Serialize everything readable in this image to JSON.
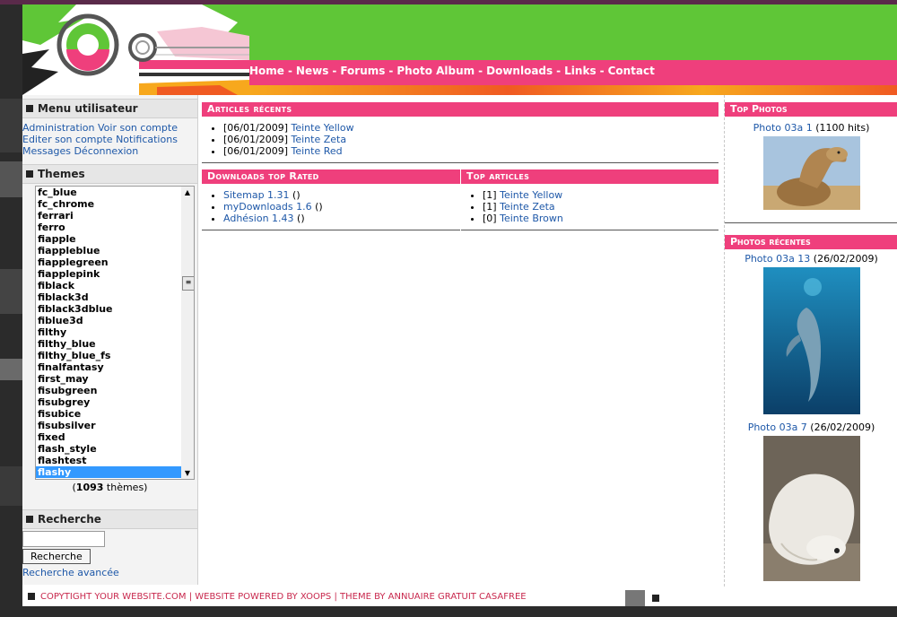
{
  "nav": [
    "Home",
    "News",
    "Forums",
    "Photo Album",
    "Downloads",
    "Links",
    "Contact"
  ],
  "nav_sep": "-",
  "user_menu": {
    "title": "Menu utilisateur",
    "links": [
      "Administration",
      "Voir son compte",
      "Editer son compte",
      "Notifications",
      "Messages",
      "Déconnexion"
    ]
  },
  "themes": {
    "title": "Themes",
    "items": [
      "fc_blue",
      "fc_chrome",
      "ferrari",
      "ferro",
      "fiapple",
      "fiappleblue",
      "fiapplegreen",
      "fiapplepink",
      "fiblack",
      "fiblack3d",
      "fiblack3dblue",
      "fiblue3d",
      "filthy",
      "filthy_blue",
      "filthy_blue_fs",
      "finalfantasy",
      "first_may",
      "fisubgreen",
      "fisubgrey",
      "fisubice",
      "fisubsilver",
      "fixed",
      "flash_style",
      "flashtest",
      "flashy"
    ],
    "selected": "flashy",
    "count_open": "(",
    "count": "1093",
    "count_label": " thèmes)"
  },
  "search": {
    "title": "Recherche",
    "input_value": "",
    "button": "Recherche",
    "advanced": "Recherche avancée"
  },
  "articles_recents": {
    "title": "Articles récents",
    "items": [
      {
        "date": "[06/01/2009]",
        "link": "Teinte Yellow"
      },
      {
        "date": "[06/01/2009]",
        "link": "Teinte Zeta"
      },
      {
        "date": "[06/01/2009]",
        "link": "Teinte Red"
      }
    ]
  },
  "downloads_top": {
    "title": "Downloads top Rated",
    "items": [
      {
        "link": "Sitemap 1.31",
        "suffix": " ()"
      },
      {
        "link": "myDownloads 1.6",
        "suffix": " ()"
      },
      {
        "link": "Adhésion 1.43",
        "suffix": " ()"
      }
    ]
  },
  "top_articles": {
    "title": "Top articles",
    "items": [
      {
        "count": "[1]",
        "link": "Teinte Yellow"
      },
      {
        "count": "[1]",
        "link": "Teinte Zeta"
      },
      {
        "count": "[0]",
        "link": "Teinte Brown"
      }
    ]
  },
  "top_photos": {
    "title": "Top Photos",
    "items": [
      {
        "link": "Photo 03a 1",
        "meta": " (1100 hits)"
      }
    ]
  },
  "recent_photos": {
    "title": "Photos récentes",
    "items": [
      {
        "link": "Photo 03a 13",
        "meta": " (26/02/2009)"
      },
      {
        "link": "Photo 03a 7",
        "meta": " (26/02/2009)"
      }
    ]
  },
  "footer": {
    "copyright": "COPYTIGHT YOUR WEBSITE.COM",
    "sep": " | ",
    "powered": "WEBSITE POWERED BY XOOPS",
    "theme": "THEME BY ANNUAIRE GRATUIT CASAFREE"
  },
  "colors": {
    "green": "#5fc637",
    "pink": "#ef3f7c",
    "orange": "#f7a81d",
    "link": "#1e58a8"
  }
}
